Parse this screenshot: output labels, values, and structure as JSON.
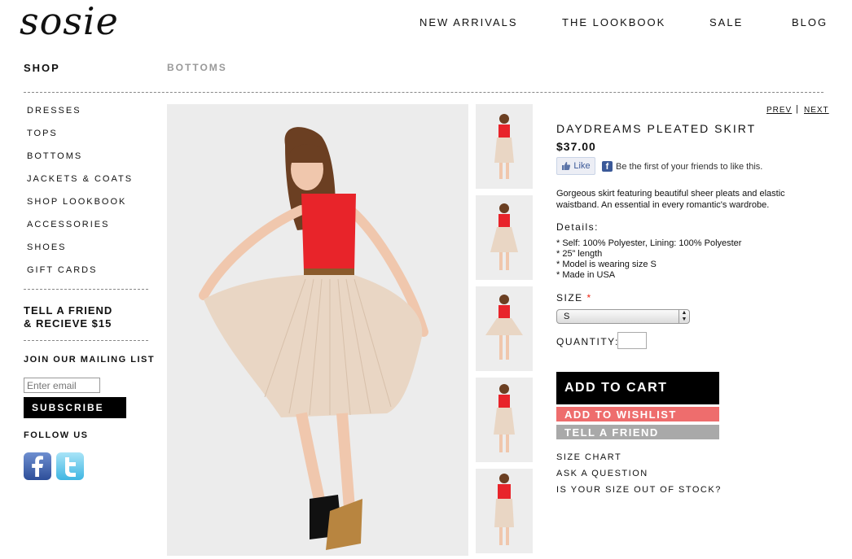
{
  "brand": {
    "logo_text": "sosie"
  },
  "nav": [
    "NEW ARRIVALS",
    "THE LOOKBOOK",
    "SALE",
    "BLOG"
  ],
  "breadcrumb": {
    "shop": "SHOP",
    "category": "BOTTOMS"
  },
  "sidebar": {
    "items": [
      "DRESSES",
      "TOPS",
      "BOTTOMS",
      "JACKETS & COATS",
      "SHOP LOOKBOOK",
      "ACCESSORIES",
      "SHOES",
      "GIFT CARDS"
    ],
    "promo_line1": "TELL A FRIEND",
    "promo_line2": "& RECIEVE $15",
    "mailing_title": "JOIN OUR MAILING LIST",
    "email_placeholder": "Enter email",
    "subscribe_label": "SUBSCRIBE",
    "follow_label": "FOLLOW US",
    "social": [
      {
        "name": "facebook-icon",
        "glyph": "f",
        "color": "#3b5998"
      },
      {
        "name": "twitter-icon",
        "glyph": "t",
        "color": "#3fb6e2"
      }
    ]
  },
  "product": {
    "prev_label": "PREV",
    "next_label": "NEXT",
    "title": "DAYDREAMS PLEATED SKIRT",
    "price": "$37.00",
    "like_label": "Like",
    "like_text": "Be the first of your friends to like this.",
    "description": "Gorgeous skirt featuring beautiful sheer pleats and elastic waistband. An essential in every romantic's wardrobe.",
    "details_heading": "Details:",
    "details": [
      "* Self: 100% Polyester, Lining: 100% Polyester",
      "* 25” length",
      "* Model is wearing size S",
      "* Made in USA"
    ],
    "size_label": "SIZE",
    "size_required_mark": "*",
    "size_value": "S",
    "quantity_label": "QUANTITY:",
    "quantity_value": "",
    "add_to_cart": "ADD TO CART",
    "add_to_wishlist": "ADD TO WISHLIST",
    "tell_a_friend": "TELL A FRIEND",
    "links": [
      "SIZE CHART",
      "ASK A QUESTION",
      "IS YOUR SIZE OUT OF STOCK?"
    ]
  },
  "colors": {
    "top": "#e8242a",
    "skirt": "#e9d6c4",
    "hair": "#6b3f22",
    "wishlist": "#ee6d6d",
    "tell": "#a9a9a9"
  }
}
